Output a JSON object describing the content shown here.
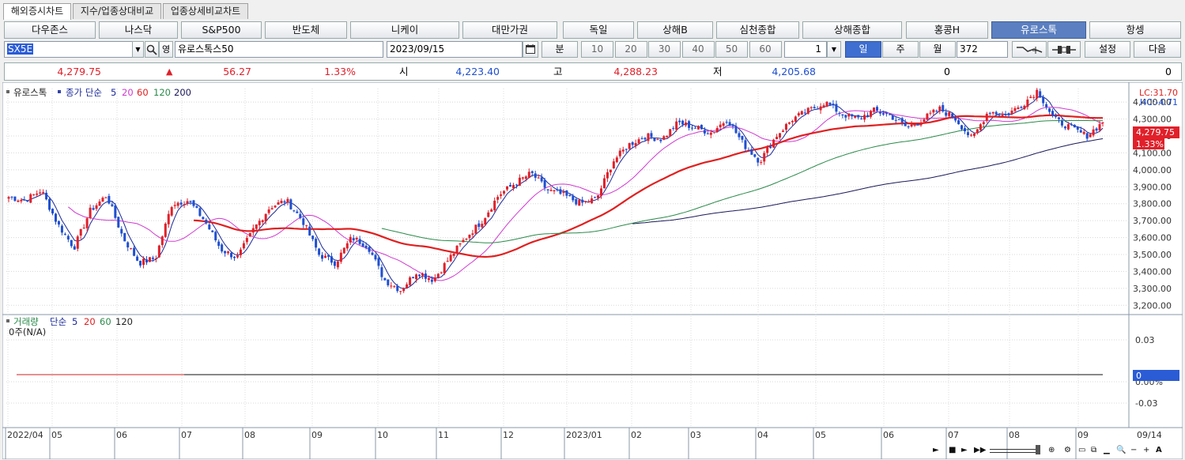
{
  "tabs": [
    "해외증시차트",
    "지수/업종상대비교",
    "업종상세비교차트"
  ],
  "markets": [
    "다우존스",
    "나스닥",
    "S&P500",
    "반도체",
    "니케이",
    "대만가권",
    "독일",
    "상해B",
    "심천종합",
    "상해종합",
    "홍콩H",
    "유로스톡",
    "항셍"
  ],
  "active_market_index": 11,
  "controls": {
    "symbol_code": "SX5E",
    "symbol_name": "유로스톡스50",
    "eng_label": "영",
    "date": "2023/09/15",
    "unit_label": "분",
    "intervals": [
      "10",
      "20",
      "30",
      "40",
      "50",
      "60"
    ],
    "count_value": "1",
    "period_day": "일",
    "period_week": "주",
    "period_month": "월",
    "bar_count": "372",
    "settings": "설정",
    "next": "다음"
  },
  "quote": {
    "price": "4,279.75",
    "arrow": "▲",
    "change": "56.27",
    "pct": "1.33%",
    "open_label": "시",
    "open": "4,223.40",
    "high_label": "고",
    "high": "4,288.23",
    "low_label": "저",
    "low": "4,205.68",
    "volume": "0",
    "amount": "0"
  },
  "price_panel": {
    "legend_name": "유로스톡",
    "legend_ma": "종가 단순",
    "ma_periods": [
      "5",
      "20",
      "60",
      "120",
      "200"
    ],
    "lc": "LC:31.70",
    "hc": "HC:-4.71",
    "last_price_tag": "4,279.75",
    "last_pct_tag": "1.33%"
  },
  "volume_panel": {
    "legend_name": "거래량",
    "legend_ma": "단순",
    "ma_periods": [
      "5",
      "20",
      "60",
      "120"
    ],
    "value": "0주(N/A)",
    "ticks": [
      "0.03",
      "0.00%",
      "-0.03"
    ],
    "zero_tag": "0",
    "pct_tag": "0.00%"
  },
  "time_axis": [
    "2022/04",
    "05",
    "06",
    "07",
    "08",
    "09",
    "10",
    "11",
    "12",
    "2023/01",
    "02",
    "03",
    "04",
    "05",
    "06",
    "07",
    "08",
    "09"
  ],
  "time_axis_right": "09/14",
  "colors": {
    "up": "#e0202a",
    "down": "#1f4fd0",
    "ma5": "#1b2a9a",
    "ma20": "#d03ad0",
    "ma60": "#e02020",
    "ma120": "#2a8a4a",
    "ma200": "#1a1a5a"
  },
  "chart_data": {
    "type": "candlestick",
    "title": "",
    "ylim": [
      3150,
      4480
    ],
    "y_ticks": [
      3200,
      3300,
      3400,
      3500,
      3600,
      3700,
      3800,
      3900,
      4000,
      4100,
      4200,
      4300,
      4400
    ],
    "x_months": [
      "2022/04",
      "05",
      "06",
      "07",
      "08",
      "09",
      "10",
      "11",
      "12",
      "2023/01",
      "02",
      "03",
      "04",
      "05",
      "06",
      "07",
      "08",
      "09"
    ],
    "anchor_closes": [
      3840,
      3820,
      3880,
      3680,
      3540,
      3760,
      3850,
      3600,
      3450,
      3480,
      3800,
      3820,
      3700,
      3530,
      3480,
      3650,
      3780,
      3820,
      3700,
      3500,
      3450,
      3600,
      3550,
      3350,
      3290,
      3400,
      3350,
      3480,
      3600,
      3700,
      3850,
      3920,
      3980,
      3880,
      3850,
      3800,
      3830,
      4050,
      4150,
      4200,
      4180,
      4280,
      4250,
      4220,
      4300,
      4150,
      4050,
      4200,
      4300,
      4350,
      4400,
      4330,
      4300,
      4350,
      4320,
      4250,
      4300,
      4360,
      4300,
      4180,
      4350,
      4320,
      4380,
      4470,
      4300,
      4250,
      4200,
      4280
    ],
    "last_close": 4279.75
  }
}
